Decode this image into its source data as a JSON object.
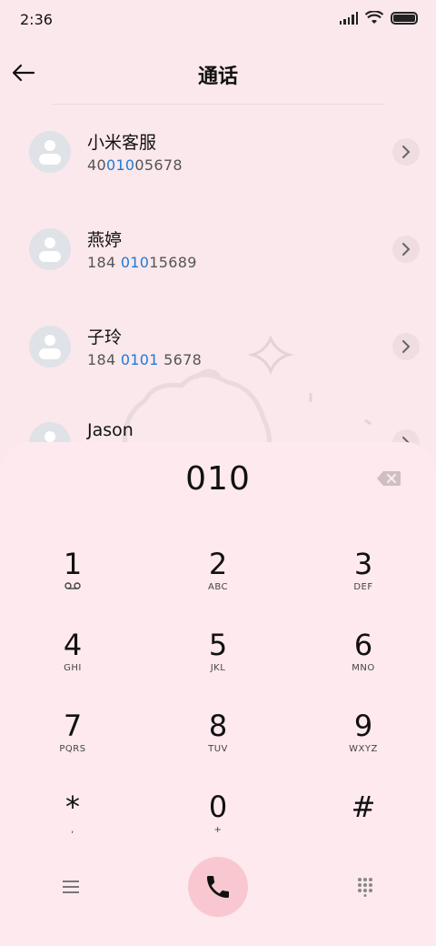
{
  "status_bar": {
    "time": "2:36"
  },
  "header": {
    "title": "通话"
  },
  "contacts": [
    {
      "name": "小米客服",
      "number_pre": "40",
      "number_hl": "010",
      "number_post": "05678"
    },
    {
      "name": "燕婷",
      "number_pre": "184 ",
      "number_hl": "010",
      "number_post": "15689"
    },
    {
      "name": "子玲",
      "number_pre": "184 ",
      "number_hl": "0101",
      "number_post": " 5678"
    },
    {
      "name": "Jason",
      "number_pre": "",
      "number_hl": "",
      "number_post": ""
    }
  ],
  "dialer": {
    "input": "010",
    "keys": [
      {
        "digit": "1",
        "sub": ""
      },
      {
        "digit": "2",
        "sub": "ABC"
      },
      {
        "digit": "3",
        "sub": "DEF"
      },
      {
        "digit": "4",
        "sub": "GHI"
      },
      {
        "digit": "5",
        "sub": "JKL"
      },
      {
        "digit": "6",
        "sub": "MNO"
      },
      {
        "digit": "7",
        "sub": "PQRS"
      },
      {
        "digit": "8",
        "sub": "TUV"
      },
      {
        "digit": "9",
        "sub": "WXYZ"
      },
      {
        "digit": "*",
        "sub": ","
      },
      {
        "digit": "0",
        "sub": "+"
      },
      {
        "digit": "#",
        "sub": ""
      }
    ]
  },
  "icons": {
    "back": "back-arrow-icon",
    "chevron": "chevron-right-icon",
    "delete": "backspace-icon",
    "menu": "menu-icon",
    "call": "phone-icon",
    "dialpad": "dialpad-icon",
    "voicemail": "voicemail-icon"
  },
  "colors": {
    "background": "#fbe8ec",
    "highlight": "#1e7ad6",
    "call_button": "#f9c7cf"
  }
}
